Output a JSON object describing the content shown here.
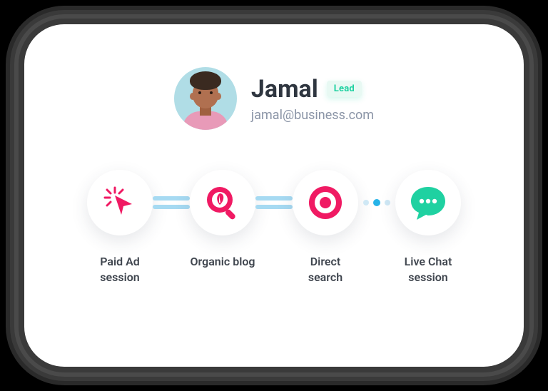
{
  "profile": {
    "name": "Jamal",
    "badge": "Lead",
    "email": "jamal@business.com"
  },
  "journey": {
    "steps": [
      {
        "icon": "cursor-click-icon",
        "label": "Paid Ad session"
      },
      {
        "icon": "leaf-search-icon",
        "label": "Organic blog"
      },
      {
        "icon": "target-icon",
        "label": "Direct search"
      },
      {
        "icon": "chat-icon",
        "label": "Live Chat session"
      }
    ],
    "connectors": [
      "double",
      "double",
      "dots"
    ]
  },
  "colors": {
    "accent_pink": "#f01a63",
    "accent_green": "#1fd1a1",
    "rail": "#a6daf2"
  }
}
